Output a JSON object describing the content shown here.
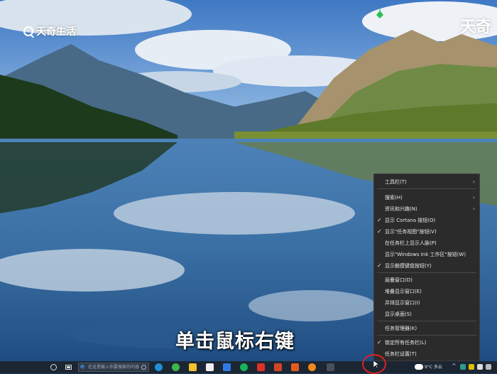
{
  "watermarks": {
    "left": "天奇生活",
    "right": "天奇"
  },
  "caption": "单击鼠标右键",
  "context_menu": {
    "items": [
      {
        "label": "工具栏(T)",
        "checked": false,
        "submenu": true
      },
      {
        "label": "搜索(H)",
        "checked": false,
        "submenu": true
      },
      {
        "label": "资讯和兴趣(N)",
        "checked": false,
        "submenu": true
      },
      {
        "label": "显示 Cortana 按钮(O)",
        "checked": true,
        "submenu": false
      },
      {
        "label": "显示\"任务视图\"按钮(V)",
        "checked": true,
        "submenu": false
      },
      {
        "label": "在任务栏上显示人脉(P)",
        "checked": false,
        "submenu": false
      },
      {
        "label": "显示\"Windows Ink 工作区\"按钮(W)",
        "checked": false,
        "submenu": false
      },
      {
        "label": "显示触摸键盘按钮(Y)",
        "checked": true,
        "submenu": false
      },
      {
        "label": "层叠窗口(D)",
        "checked": false,
        "submenu": false
      },
      {
        "label": "堆叠显示窗口(E)",
        "checked": false,
        "submenu": false
      },
      {
        "label": "并排显示窗口(I)",
        "checked": false,
        "submenu": false
      },
      {
        "label": "显示桌面(S)",
        "checked": false,
        "submenu": false
      },
      {
        "label": "任务管理器(K)",
        "checked": false,
        "submenu": false
      },
      {
        "label": "锁定所有任务栏(L)",
        "checked": true,
        "submenu": false
      },
      {
        "label": "任务栏设置(T)",
        "checked": false,
        "submenu": false
      }
    ]
  },
  "taskbar": {
    "search_placeholder": "在这里输入你要搜索的内容",
    "weather": "9°C 多云",
    "apps": [
      "edge-icon",
      "chrome-icon",
      "explorer-icon",
      "store-icon",
      "wechat-icon",
      "wps-icon",
      "photo-icon",
      "office-icon",
      "firefox-icon"
    ]
  }
}
